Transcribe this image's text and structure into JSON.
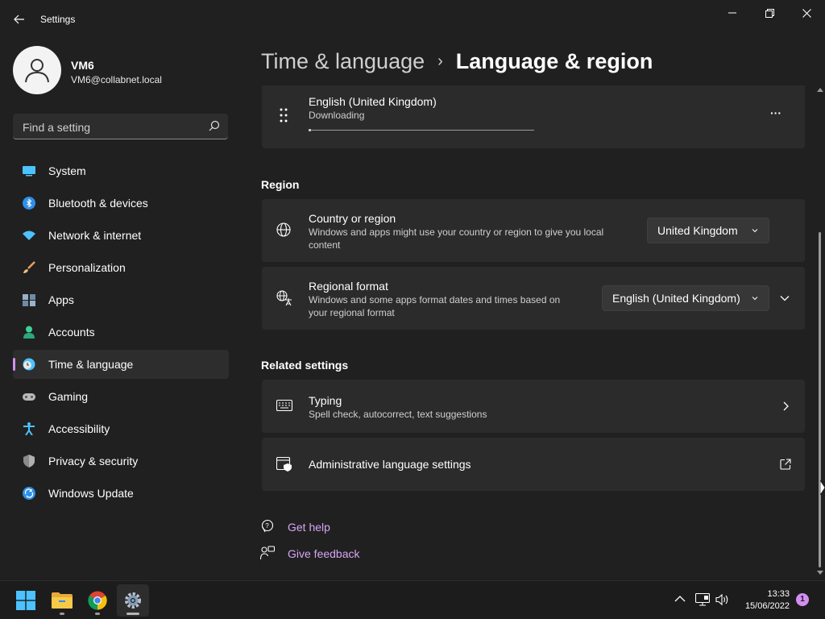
{
  "window": {
    "title": "Settings"
  },
  "user": {
    "name": "VM6",
    "email": "VM6@collabnet.local"
  },
  "search": {
    "placeholder": "Find a setting"
  },
  "sidebar": {
    "items": [
      {
        "label": "System",
        "icon": "system-icon"
      },
      {
        "label": "Bluetooth & devices",
        "icon": "bluetooth-icon"
      },
      {
        "label": "Network & internet",
        "icon": "network-icon"
      },
      {
        "label": "Personalization",
        "icon": "brush-icon"
      },
      {
        "label": "Apps",
        "icon": "apps-icon"
      },
      {
        "label": "Accounts",
        "icon": "accounts-icon"
      },
      {
        "label": "Time & language",
        "icon": "time-language-icon",
        "active": true
      },
      {
        "label": "Gaming",
        "icon": "gamepad-icon"
      },
      {
        "label": "Accessibility",
        "icon": "accessibility-icon"
      },
      {
        "label": "Privacy & security",
        "icon": "shield-icon"
      },
      {
        "label": "Windows Update",
        "icon": "update-icon"
      }
    ]
  },
  "breadcrumb": {
    "parent": "Time & language",
    "separator": "›",
    "current": "Language & region"
  },
  "language_card": {
    "title": "English (United Kingdom)",
    "status": "Downloading",
    "progress_fraction": 0.01,
    "more_label": "···"
  },
  "region": {
    "section_title": "Region",
    "country": {
      "title": "Country or region",
      "desc_line1": "Windows and apps might use your country or region to give you local",
      "desc_line2": "content",
      "value": "United Kingdom"
    },
    "format": {
      "title": "Regional format",
      "desc_line1": "Windows and some apps format dates and times based on",
      "desc_line2": "your regional format",
      "value": "English (United Kingdom)"
    }
  },
  "related": {
    "section_title": "Related settings",
    "typing": {
      "title": "Typing",
      "desc": "Spell check, autocorrect, text suggestions"
    },
    "admin": {
      "title": "Administrative language settings"
    }
  },
  "help_links": {
    "get_help": "Get help",
    "give_feedback": "Give feedback"
  },
  "taskbar": {
    "apps": [
      "start-icon",
      "file-explorer-icon",
      "chrome-icon",
      "settings-icon"
    ],
    "time": "13:33",
    "date": "15/06/2022",
    "notification_count": "1"
  },
  "colors": {
    "accent": "#d38ef0",
    "background": "#202020",
    "card": "#2b2b2b"
  }
}
